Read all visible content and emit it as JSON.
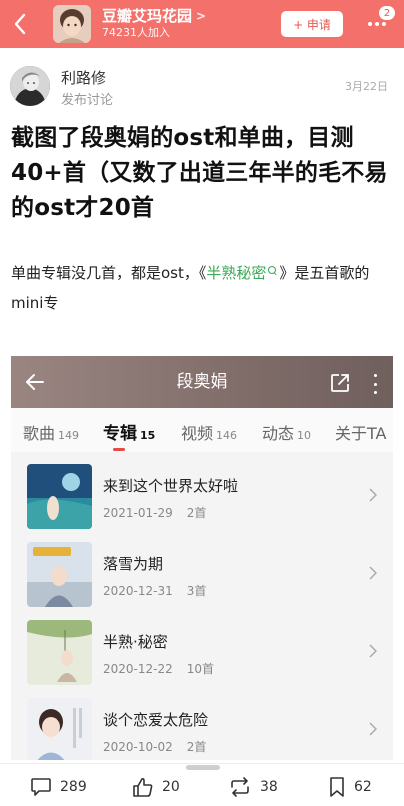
{
  "header": {
    "group_name": "豆瓣艾玛花园",
    "member_count": "74231人加入",
    "apply_label": "+ 申请",
    "notification_badge": "2",
    "color": "#f4716b"
  },
  "post": {
    "author": "利路修",
    "action": "发布讨论",
    "date": "3月22日",
    "title": "截图了段奥娟的ost和单曲，目测40+首（又数了出道三年半的毛不易的ost才20首",
    "body_before": "单曲专辑没几首，都是ost，《",
    "body_link": "半熟秘密",
    "body_after": "》是五首歌的mini专",
    "link_color": "#3aa858"
  },
  "screenshot": {
    "artist": "段奥娟",
    "tabs": [
      {
        "label": "歌曲",
        "count": "149"
      },
      {
        "label": "专辑",
        "count": "15"
      },
      {
        "label": "视频",
        "count": "146"
      },
      {
        "label": "动态",
        "count": "10"
      },
      {
        "label": "关于TA",
        "count": ""
      }
    ],
    "active_tab": "专辑",
    "albums": [
      {
        "name": "来到这个世界太好啦",
        "date": "2021-01-29",
        "tracks": "2首"
      },
      {
        "name": "落雪为期",
        "date": "2020-12-31",
        "tracks": "3首"
      },
      {
        "name": "半熟·秘密",
        "date": "2020-12-22",
        "tracks": "10首"
      },
      {
        "name": "谈个恋爱太危险",
        "date": "2020-10-02",
        "tracks": "2首"
      }
    ]
  },
  "actions": {
    "comments": "289",
    "likes": "20",
    "reshares": "38",
    "collects": "62"
  }
}
